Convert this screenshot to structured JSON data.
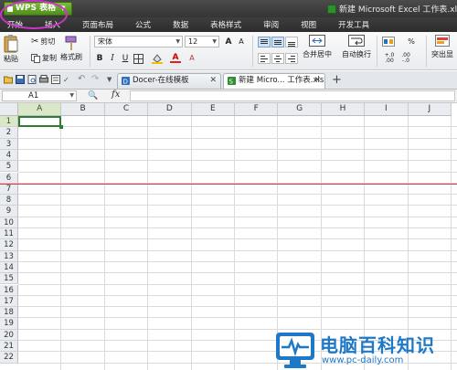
{
  "app": {
    "menu_label": "WPS 表格",
    "window_title": "新建 Microsoft Excel 工作表.xls - W"
  },
  "menu_tabs": [
    "开始",
    "插入",
    "页面布局",
    "公式",
    "数据",
    "表格样式",
    "审阅",
    "视图",
    "开发工具"
  ],
  "ribbon": {
    "paste": "粘贴",
    "cut": "剪切",
    "copy": "复制",
    "format_painter": "格式刷",
    "font_name": "宋体",
    "font_size": "12",
    "bold": "B",
    "italic": "I",
    "underline": "U",
    "merge_center": "合并居中",
    "wrap_text": "自动换行",
    "highlight_dup": "突出显"
  },
  "doc_tabs": [
    {
      "label": "Docer-在线模板"
    },
    {
      "label": "新建 Micro... 工作表.xls"
    }
  ],
  "formula_bar": {
    "cell_ref": "A1",
    "fx": "fx",
    "value": ""
  },
  "grid": {
    "columns": [
      "A",
      "B",
      "C",
      "D",
      "E",
      "F",
      "G",
      "H",
      "I",
      "J"
    ],
    "rows": [
      "1",
      "2",
      "3",
      "4",
      "5",
      "6",
      "7",
      "8",
      "9",
      "10",
      "11",
      "12",
      "13",
      "14",
      "15",
      "16",
      "17",
      "18",
      "19",
      "20",
      "21",
      "22"
    ],
    "selected_cell": "A1"
  },
  "watermark": {
    "title": "电脑百科知识",
    "url": "www.pc-daily.com"
  },
  "colors": {
    "accent_green": "#2e7d32",
    "annotation_magenta": "#c935c9",
    "annotation_red": "#e0303a",
    "watermark_blue": "#1e78c8"
  }
}
